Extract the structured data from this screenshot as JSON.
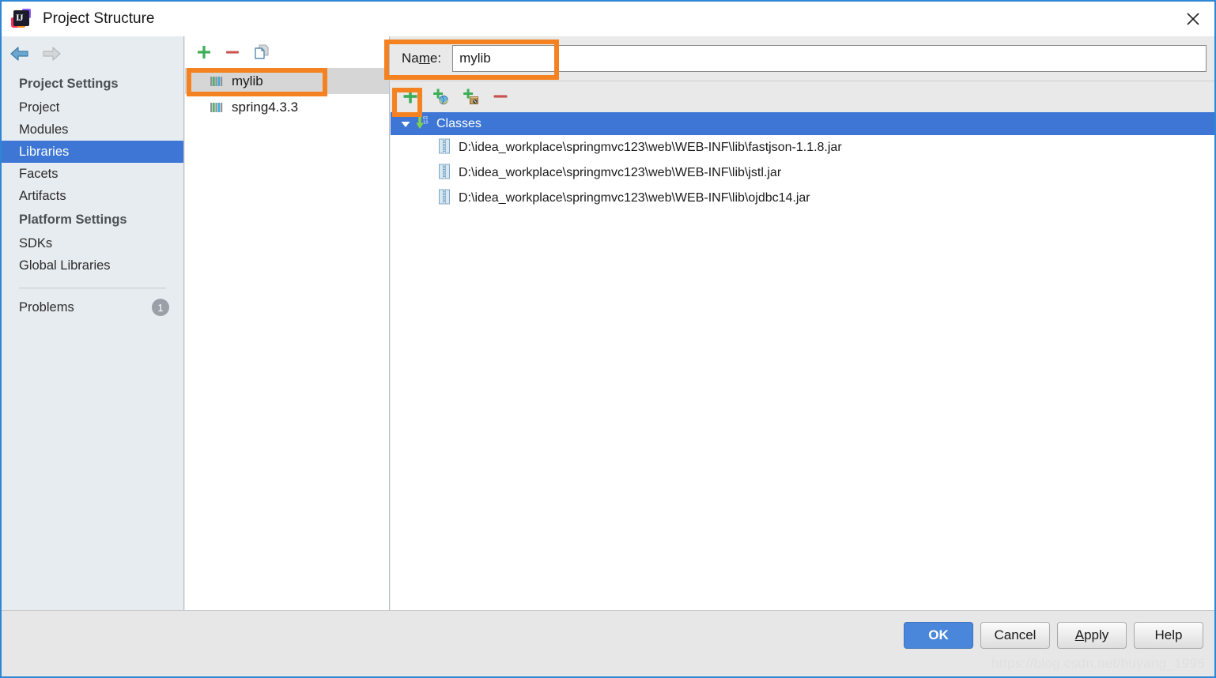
{
  "window": {
    "title": "Project Structure",
    "app_icon": "intellij-idea-logo",
    "close_icon": "close-icon"
  },
  "sidebar": {
    "nav": {
      "back_icon": "arrow-left-icon",
      "forward_icon": "arrow-right-icon"
    },
    "sections": [
      {
        "header": "Project Settings",
        "items": [
          {
            "label": "Project",
            "selected": false
          },
          {
            "label": "Modules",
            "selected": false
          },
          {
            "label": "Libraries",
            "selected": true
          },
          {
            "label": "Facets",
            "selected": false
          },
          {
            "label": "Artifacts",
            "selected": false
          }
        ]
      },
      {
        "header": "Platform Settings",
        "items": [
          {
            "label": "SDKs",
            "selected": false
          },
          {
            "label": "Global Libraries",
            "selected": false
          }
        ]
      }
    ],
    "problems": {
      "label": "Problems",
      "count": "1"
    }
  },
  "library_panel": {
    "toolbar": [
      {
        "name": "add-library-button",
        "icon": "plus-icon",
        "label": "+"
      },
      {
        "name": "remove-library-button",
        "icon": "minus-icon",
        "label": "−"
      },
      {
        "name": "copy-library-button",
        "icon": "copy-icon",
        "label": "copy"
      }
    ],
    "libraries": [
      {
        "name": "mylib",
        "selected": true
      },
      {
        "name": "spring4.3.3",
        "selected": false
      }
    ]
  },
  "detail": {
    "name_label_pre": "Na",
    "name_label_mnemonic": "m",
    "name_label_post": "e:",
    "name_value": "mylib",
    "name_placeholder": "",
    "roots_toolbar": [
      {
        "name": "add-root-button",
        "icon": "plus-icon"
      },
      {
        "name": "add-from-repository-button",
        "icon": "plus-globe-icon"
      },
      {
        "name": "add-from-archive-button",
        "icon": "plus-box-icon"
      },
      {
        "name": "remove-root-button",
        "icon": "minus-icon"
      }
    ],
    "tree": {
      "group_label": "Classes",
      "group_icon": "classes-root-icon",
      "expander_icon": "triangle-down-icon",
      "expanded": true,
      "nodes": [
        {
          "icon": "jar-file-icon",
          "path": "D:\\idea_workplace\\springmvc123\\web\\WEB-INF\\lib\\fastjson-1.1.8.jar"
        },
        {
          "icon": "jar-file-icon",
          "path": "D:\\idea_workplace\\springmvc123\\web\\WEB-INF\\lib\\jstl.jar"
        },
        {
          "icon": "jar-file-icon",
          "path": "D:\\idea_workplace\\springmvc123\\web\\WEB-INF\\lib\\ojdbc14.jar"
        }
      ]
    }
  },
  "footer": {
    "buttons": [
      {
        "name": "ok-button",
        "label": "OK",
        "primary": true
      },
      {
        "name": "cancel-button",
        "label": "Cancel",
        "primary": false
      },
      {
        "name": "apply-button",
        "label": "Apply",
        "primary": false,
        "mnemonic": "A"
      },
      {
        "name": "help-button",
        "label": "Help",
        "primary": false
      }
    ],
    "apply_pre": "",
    "apply_mnemonic": "A",
    "apply_post": "pply"
  },
  "watermark": "https://blog.csdn.net/huyang_1995",
  "colors": {
    "selection_blue": "#3d76d4",
    "accent_orange": "#f58220",
    "primary_button": "#4a87da",
    "sidebar_bg": "#e7ecf0"
  }
}
